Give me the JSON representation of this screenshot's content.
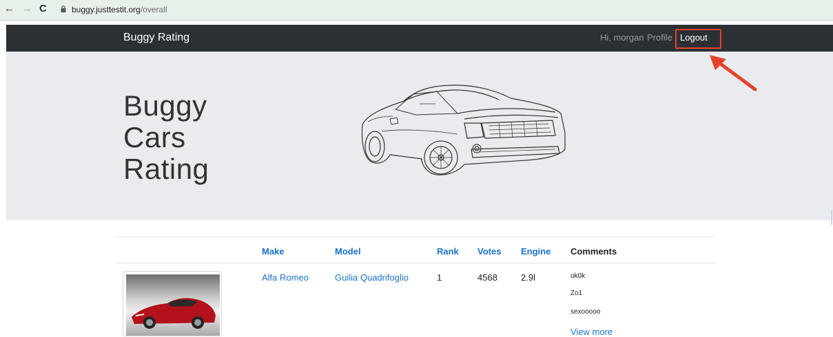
{
  "browser": {
    "url_host": "buggy.justtestit.org",
    "url_path": "/overall"
  },
  "navbar": {
    "brand": "Buggy Rating",
    "greeting": "Hi, morgan",
    "profile": "Profile",
    "logout": "Logout"
  },
  "hero": {
    "title_lines": [
      "Buggy",
      "Cars",
      "Rating"
    ]
  },
  "table": {
    "headers": [
      "Make",
      "Model",
      "Rank",
      "Votes",
      "Engine",
      "Comments"
    ],
    "rows": [
      {
        "make": "Alfa Romeo",
        "model": "Guilia Quadrifoglio",
        "rank": "1",
        "votes": "4568",
        "engine": "2.9l",
        "comments": [
          "ok0k",
          "Zo1",
          "sexooooo"
        ],
        "view_more": "View more"
      }
    ]
  },
  "colors": {
    "navbar_bg": "#2b3034",
    "hero_bg": "#e9ebee",
    "link": "#1a72c9",
    "annotation": "#e8412b"
  },
  "icons": [
    "back-arrow-icon",
    "forward-arrow-icon",
    "reload-icon",
    "lock-icon",
    "car-outline-illustration",
    "annotation-arrow"
  ]
}
